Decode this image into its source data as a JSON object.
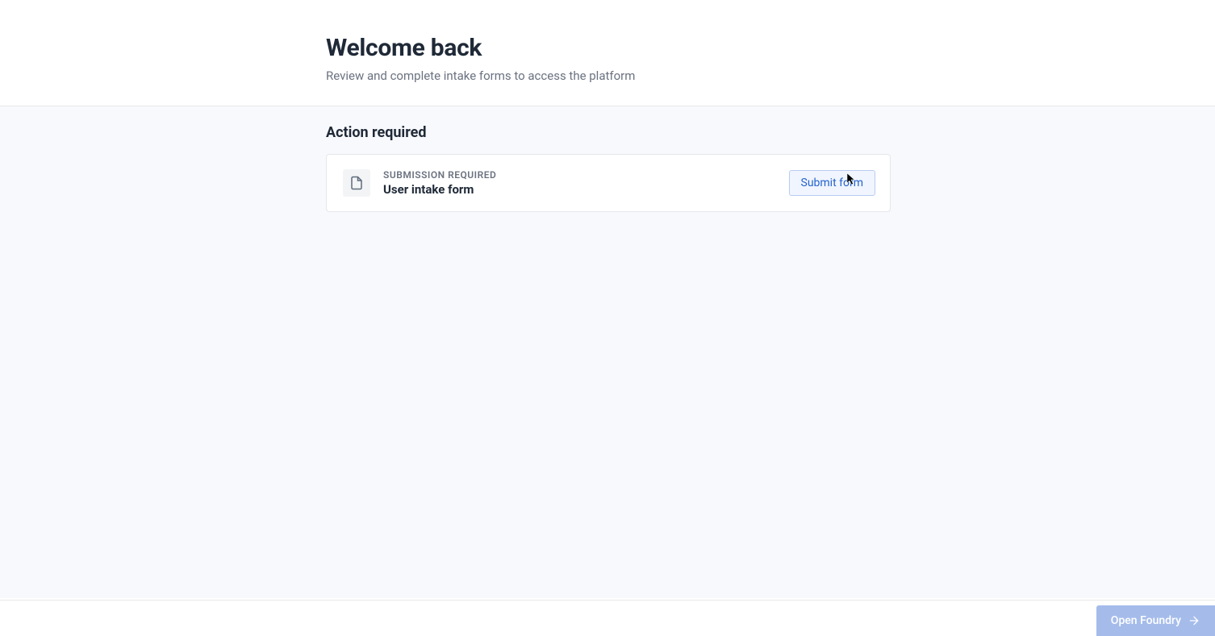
{
  "header": {
    "title": "Welcome back",
    "subtitle": "Review and complete intake forms to access the platform"
  },
  "section": {
    "title": "Action required"
  },
  "card": {
    "status_label": "SUBMISSION REQUIRED",
    "form_name": "User intake form",
    "button_label": "Submit form"
  },
  "footer": {
    "button_label": "Open Foundry"
  }
}
